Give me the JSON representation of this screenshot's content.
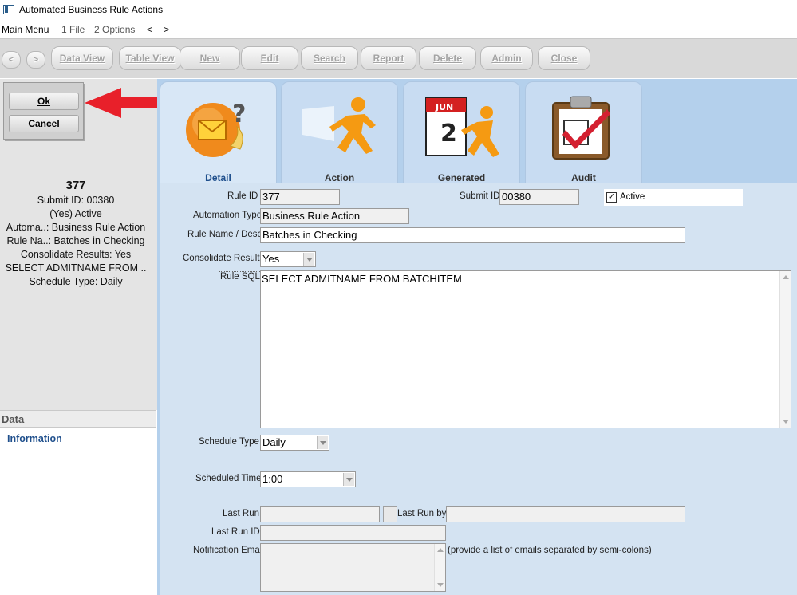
{
  "window": {
    "title": "Automated Business Rule Actions"
  },
  "menu": {
    "main": "Main Menu",
    "file": "1 File",
    "options": "2 Options",
    "back": "<",
    "forward": ">"
  },
  "toolbar": {
    "back": "<",
    "forward": ">",
    "data_view": "Data View",
    "table_view": "Table View",
    "new": "New",
    "edit": "Edit",
    "search": "Search",
    "report": "Report",
    "delete": "Delete",
    "admin": "Admin",
    "close": "Close"
  },
  "dialog": {
    "ok": "Ok",
    "cancel": "Cancel"
  },
  "summary": {
    "rule_id": "377",
    "submit_id": "Submit ID: 00380",
    "active": "(Yes) Active",
    "automation": "Automa..: Business Rule Action",
    "rule_name": "Rule Na..: Batches in Checking",
    "consolidate": "Consolidate Results: Yes",
    "sql": "SELECT ADMITNAME FROM ..",
    "schedule": "Schedule Type: Daily"
  },
  "left_nav": {
    "section": "Data",
    "item": "Information"
  },
  "tabs": [
    {
      "label": "Detail",
      "icon": "email-help-icon"
    },
    {
      "label": "Action",
      "icon": "running-man-icon"
    },
    {
      "label": "Generated",
      "icon": "calendar-runner-icon"
    },
    {
      "label": "Audit",
      "icon": "clipboard-check-icon"
    }
  ],
  "calendar_icon": {
    "month": "JUN",
    "day": "2"
  },
  "form": {
    "rule_id_label": "Rule ID",
    "rule_id": "377",
    "submit_id_label": "Submit ID",
    "submit_id": "00380",
    "active_label": "Active",
    "active_checked": "✓",
    "automation_type_label": "Automation Type",
    "automation_type": "Business Rule Action",
    "rule_name_label": "Rule Name / Desc",
    "rule_name": "Batches in Checking",
    "consolidate_label": "Consolidate Results",
    "consolidate": "Yes",
    "rule_sql_label": "Rule SQL",
    "rule_sql": "SELECT ADMITNAME FROM BATCHITEM",
    "schedule_type_label": "Schedule Type",
    "schedule_type": "Daily",
    "scheduled_time_label": "Scheduled Time",
    "scheduled_time": "1:00",
    "last_run_label": "Last Run",
    "last_run": "",
    "last_run_by_label": "Last Run by",
    "last_run_by": "",
    "last_run_id_label": "Last Run ID",
    "last_run_id": "",
    "notification_label": "Notification Email(s",
    "notification_hint": "(provide a list of emails separated by semi-colons)"
  },
  "colors": {
    "accent_blue": "#1f4f8c",
    "tab_bg": "#b4d0ec",
    "form_bg": "#d4e3f2",
    "arrow_red": "#e8202a"
  }
}
